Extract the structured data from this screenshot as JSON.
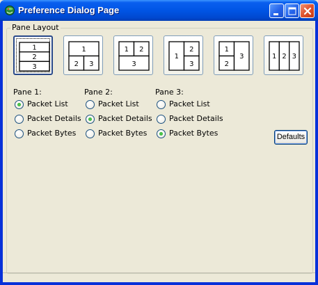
{
  "window": {
    "title": "Preference Dialog Page"
  },
  "group": {
    "label": "Pane Layout"
  },
  "layouts": [
    {
      "id": "layout-1",
      "labels": [
        "1",
        "2",
        "3"
      ],
      "selected": true
    },
    {
      "id": "layout-2",
      "labels": [
        "1",
        "2",
        "3"
      ],
      "selected": false
    },
    {
      "id": "layout-3",
      "labels": [
        "1",
        "2",
        "3"
      ],
      "selected": false
    },
    {
      "id": "layout-4",
      "labels": [
        "1",
        "2",
        "3"
      ],
      "selected": false
    },
    {
      "id": "layout-5",
      "labels": [
        "1",
        "2",
        "3"
      ],
      "selected": false
    },
    {
      "id": "layout-6",
      "labels": [
        "1",
        "2",
        "3"
      ],
      "selected": false
    }
  ],
  "panes": [
    {
      "heading": "Pane 1:",
      "options": [
        "Packet List",
        "Packet Details",
        "Packet Bytes"
      ],
      "selected_index": 0
    },
    {
      "heading": "Pane 2:",
      "options": [
        "Packet List",
        "Packet Details",
        "Packet Bytes"
      ],
      "selected_index": 1
    },
    {
      "heading": "Pane 3:",
      "options": [
        "Packet List",
        "Packet Details",
        "Packet Bytes"
      ],
      "selected_index": 2
    }
  ],
  "buttons": {
    "defaults": "Defaults"
  },
  "icons": {
    "app": "app-icon",
    "minimize": "minimize-icon",
    "maximize": "maximize-icon",
    "close": "close-icon"
  },
  "colors": {
    "title_bar": "#0055e5",
    "dialog_bg": "#ece9d8",
    "radio_dot": "#21a121",
    "close_button": "#e0532e"
  }
}
